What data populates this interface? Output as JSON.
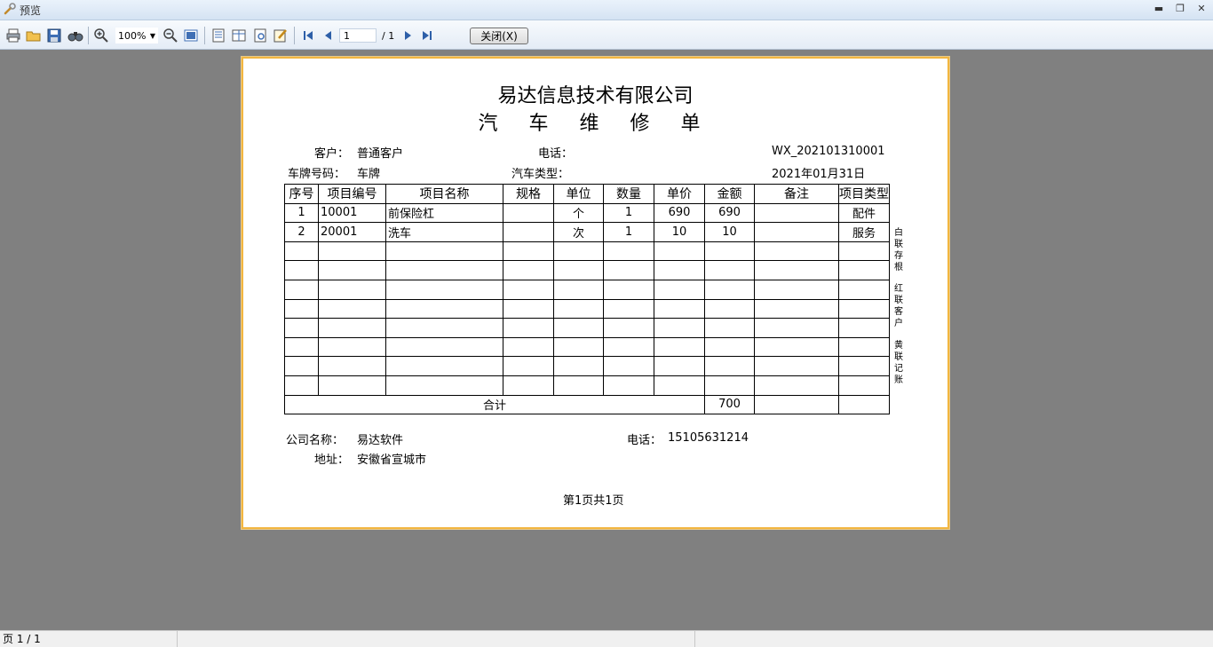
{
  "window": {
    "title": "预览",
    "minimize": "▬",
    "restore": "❐",
    "close": "✕"
  },
  "toolbar": {
    "zoom_value": "100%",
    "page_current": "1",
    "page_total": "/ 1",
    "close_label": "关闭(X)",
    "icons": [
      "print-icon",
      "open-icon",
      "save-icon",
      "find-icon",
      "zoom-in-icon",
      "zoom-out-icon",
      "fit-page-icon",
      "single-page-icon",
      "multi-page-icon",
      "page-setup-icon",
      "edit-icon",
      "first-page-icon",
      "prev-page-icon",
      "next-page-icon",
      "last-page-icon"
    ]
  },
  "document": {
    "company": "易达信息技术有限公司",
    "title": "汽 车 维 修 单",
    "customer_label": "客户：",
    "customer_value": "普通客户",
    "phone_label": "电话：",
    "order_no": "WX_202101310001",
    "plate_label": "车牌号码：",
    "plate_value": "车牌",
    "car_type_label": "汽车类型：",
    "date": "2021年01月31日",
    "table": {
      "headers": [
        "序号",
        "项目编号",
        "项目名称",
        "规格",
        "单位",
        "数量",
        "单价",
        "金额",
        "备注",
        "项目类型"
      ],
      "rows": [
        [
          "1",
          "10001",
          "前保险杠",
          "",
          "个",
          "1",
          "690",
          "690",
          "",
          "配件"
        ],
        [
          "2",
          "20001",
          "洗车",
          "",
          "次",
          "1",
          "10",
          "10",
          "",
          "服务"
        ]
      ],
      "empty_rows": 8,
      "total_label": "合计",
      "total_value": "700"
    },
    "side_notes": [
      "白联存根",
      "红联客户",
      "黄联记账"
    ],
    "footer": {
      "company_label": "公司名称：",
      "company_value": "易达软件",
      "phone_label": "电话：",
      "phone_value": "15105631214",
      "address_label": "地址：",
      "address_value": "安徽省宣城市",
      "page_info": "第1页共1页"
    }
  },
  "status": {
    "page": "页 1 / 1"
  }
}
